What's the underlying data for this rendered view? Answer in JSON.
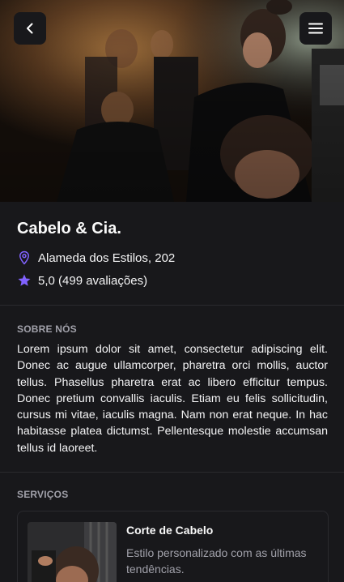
{
  "nav": {
    "back_icon": "chevron-left-icon",
    "menu_icon": "menu-icon"
  },
  "hero": {
    "image": "barbershop-photo"
  },
  "shop": {
    "name": "Cabelo & Cia.",
    "address": "Alameda dos Estilos, 202",
    "address_icon": "map-pin-icon",
    "rating": "5,0 (499 avaliações)",
    "rating_icon": "star-icon"
  },
  "about": {
    "label": "SOBRE NÓS",
    "text": "Lorem ipsum dolor sit amet, consectetur adipiscing elit. Donec ac augue ullamcorper, pharetra orci mollis, auctor tellus. Phasellus pharetra erat ac libero efficitur tempus. Donec pretium convallis iaculis. Etiam eu felis sollicitudin, cursus mi vitae, iaculis magna. Nam non erat neque. In hac habitasse platea dictumst. Pellentesque molestie accumsan tellus id laoreet."
  },
  "services": {
    "label": "SERVIÇOS",
    "items": [
      {
        "name": "Corte de Cabelo",
        "description": "Estilo personalizado com as últimas tendências."
      }
    ]
  },
  "colors": {
    "background": "#18181b",
    "accent": "#8162ff",
    "muted_text": "#a1a1aa",
    "border": "#2a2a2e"
  }
}
